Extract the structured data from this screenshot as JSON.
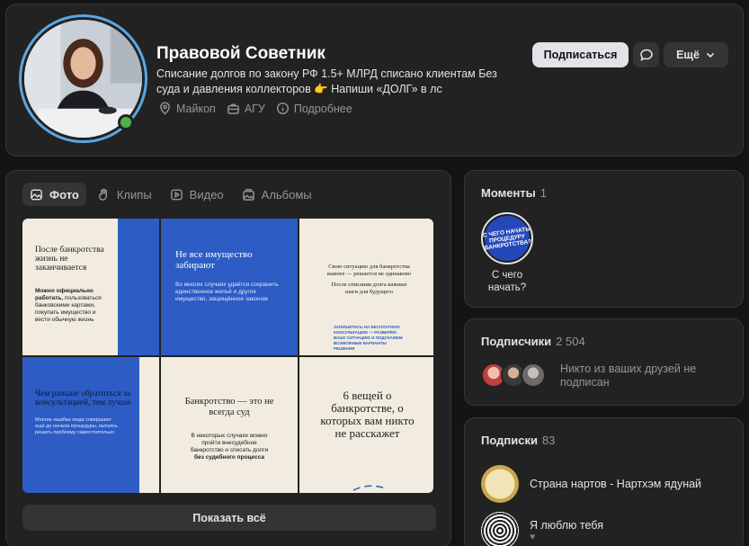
{
  "profile": {
    "name": "Правовой Советник",
    "status": "Списание долгов по закону РФ 1.5+ МЛРД списано клиентам Без суда и давления коллекторов 👉 Напиши «ДОЛГ» в лс",
    "meta": {
      "location": "Майкоп",
      "education": "АГУ",
      "details": "Подробнее"
    },
    "subscribe_label": "Подписаться",
    "more_label": "Ещё"
  },
  "media": {
    "tabs": [
      {
        "label": "Фото",
        "icon": "photo-icon"
      },
      {
        "label": "Клипы",
        "icon": "clips-icon"
      },
      {
        "label": "Видео",
        "icon": "video-icon"
      },
      {
        "label": "Альбомы",
        "icon": "albums-icon"
      }
    ],
    "tiles": [
      {
        "heading": "После банкротства жизнь не заканчивается",
        "body_bold": "Можно официально работать,",
        "body": " пользоваться банковскими картами, покупать имущество и вести обычную жизнь"
      },
      {
        "heading": "Не все имущество забирают",
        "body": "Во многих случаях удаётся сохранить единственное жильё и другое имущество, защищённое законом"
      },
      {
        "heading": "Свою ситуацию для банкротства важнее — решается не одинаково",
        "body": "После списания долга важные шаги для будущего",
        "footer": "ЗАПИШИТЕСЬ НА БЕСПЛАТНУЮ КОНСУЛЬТАЦИЮ — РАЗБЕРЁМ ВАШУ СИТУАЦИЮ И ПОДСКАЖЕМ ВОЗМОЖНЫЕ ВАРИАНТЫ РЕШЕНИЯ"
      },
      {
        "heading": "Чем раньше обратиться за консультацией, тем лучше",
        "body": "Многие ошибки люди совершают ещё до начала процедуры, пытаясь решить проблему самостоятельно"
      },
      {
        "heading": "Банкротство — это не всегда суд",
        "body": "В некоторых случаях можно пройти внесудебное банкротство и списать долги",
        "body_bold": "без судебного процесса"
      },
      {
        "heading": "6 вещей о банкротстве, о которых вам никто не расскажет"
      }
    ],
    "show_all_label": "Показать всё"
  },
  "moments": {
    "title": "Моменты",
    "count": "1",
    "items": [
      {
        "cover_text": "С ЧЕГО НАЧАТЬ ПРОЦЕДУРУ БАНКРОТСТВА?",
        "label": "С чего начать?"
      }
    ]
  },
  "subscribers": {
    "title": "Подписчики",
    "count": "2 504",
    "friends_text": "Никто из ваших друзей не подписан"
  },
  "subscriptions": {
    "title": "Подписки",
    "count": "83",
    "items": [
      {
        "name": "Страна нартов - Нартхэм ядунай"
      },
      {
        "name": "Я люблю тебя"
      }
    ]
  },
  "colors": {
    "accent_blue": "#2c5cc4",
    "background": "#141414",
    "card": "#222222",
    "online": "#4bb34b"
  }
}
